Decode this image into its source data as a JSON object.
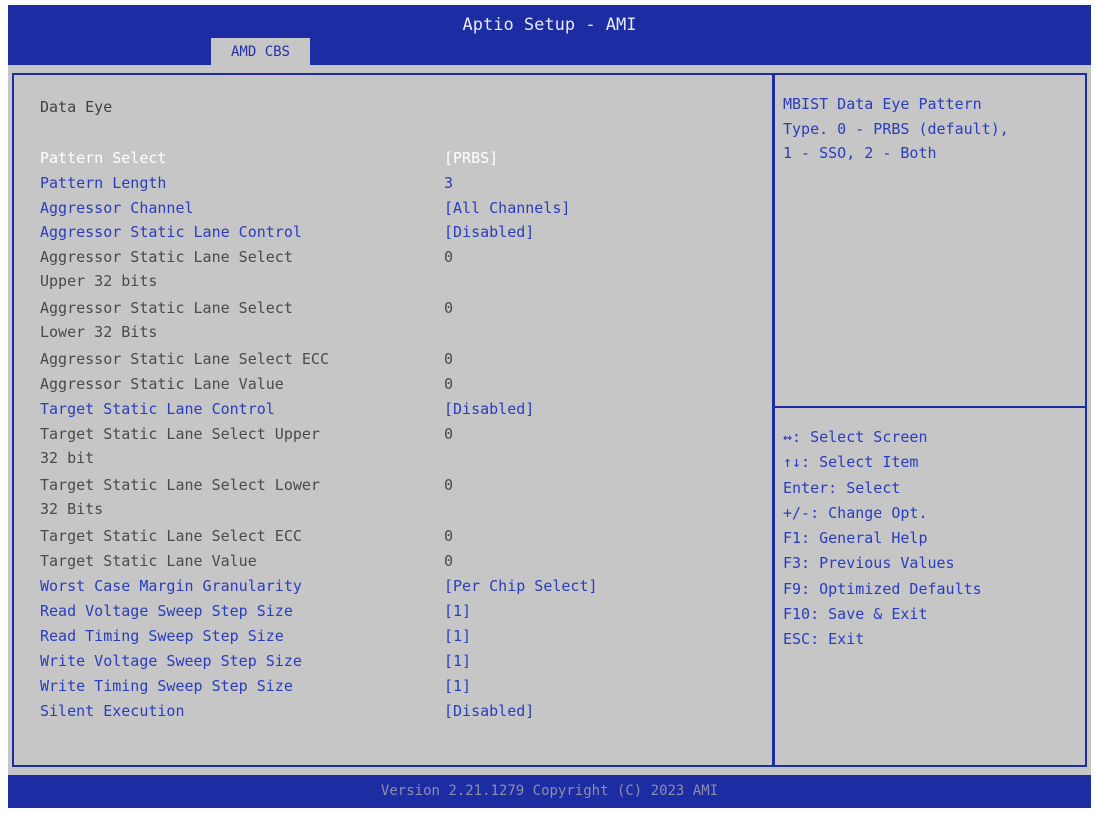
{
  "window": {
    "title": "Aptio Setup - AMI",
    "active_tab": "AMD CBS"
  },
  "main": {
    "section_title": "Data Eye",
    "items": [
      {
        "label": "Pattern Select",
        "value": "[PRBS]"
      },
      {
        "label": "Pattern Length",
        "value": "3"
      },
      {
        "label": "Aggressor Channel",
        "value": "[All Channels]"
      },
      {
        "label": "Aggressor Static Lane Control",
        "value": "[Disabled]"
      },
      {
        "label": "Aggressor Static Lane Select\nUpper 32 bits",
        "value": "0"
      },
      {
        "label": "Aggressor Static Lane Select\nLower 32 Bits",
        "value": "0"
      },
      {
        "label": "Aggressor Static Lane Select ECC",
        "value": "0"
      },
      {
        "label": "Aggressor Static Lane Value",
        "value": "0"
      },
      {
        "label": "Target Static Lane Control",
        "value": "[Disabled]"
      },
      {
        "label": "Target Static Lane Select Upper\n32 bit",
        "value": "0"
      },
      {
        "label": "Target Static Lane Select Lower\n32 Bits",
        "value": "0"
      },
      {
        "label": "Target Static Lane Select ECC",
        "value": "0"
      },
      {
        "label": "Target Static Lane Value",
        "value": "0"
      },
      {
        "label": "Worst Case Margin Granularity",
        "value": "[Per Chip Select]"
      },
      {
        "label": "Read Voltage Sweep Step Size",
        "value": "[1]"
      },
      {
        "label": "Read Timing Sweep Step Size",
        "value": "[1]"
      },
      {
        "label": "Write Voltage Sweep Step Size",
        "value": "[1]"
      },
      {
        "label": "Write Timing Sweep Step Size",
        "value": "[1]"
      },
      {
        "label": "Silent Execution",
        "value": "[Disabled]"
      }
    ]
  },
  "side": {
    "help_text": "MBIST Data Eye Pattern\nType. 0 - PRBS (default),\n1 - SSO, 2 - Both",
    "keys": [
      "↔: Select Screen",
      "↑↓: Select Item",
      "Enter: Select",
      "+/-: Change Opt.",
      "F1: General Help",
      "F3: Previous Values",
      "F9: Optimized Defaults",
      "F10: Save & Exit",
      "ESC: Exit"
    ]
  },
  "footer": {
    "text": "Version 2.21.1279 Copyright (C) 2023 AMI"
  }
}
